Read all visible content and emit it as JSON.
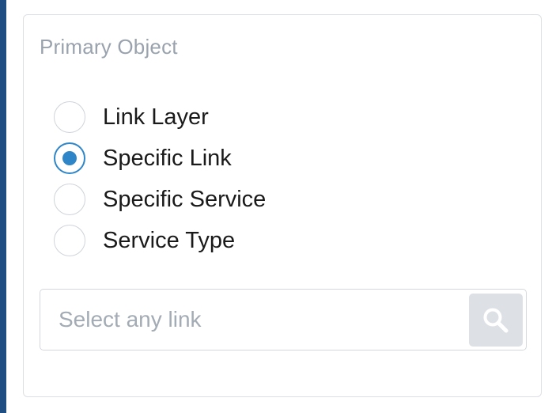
{
  "panel": {
    "title": "Primary Object"
  },
  "radio_options": [
    {
      "label": "Link Layer",
      "checked": false
    },
    {
      "label": "Specific Link",
      "checked": true
    },
    {
      "label": "Specific Service",
      "checked": false
    },
    {
      "label": "Service Type",
      "checked": false
    }
  ],
  "search": {
    "placeholder": "Select any link",
    "value": "",
    "button_icon": "search-icon"
  },
  "colors": {
    "accent": "#2e86c9",
    "side_strip": "#1f4e82",
    "muted_text": "#9aa3ad",
    "button_bg": "#dde1e5"
  }
}
